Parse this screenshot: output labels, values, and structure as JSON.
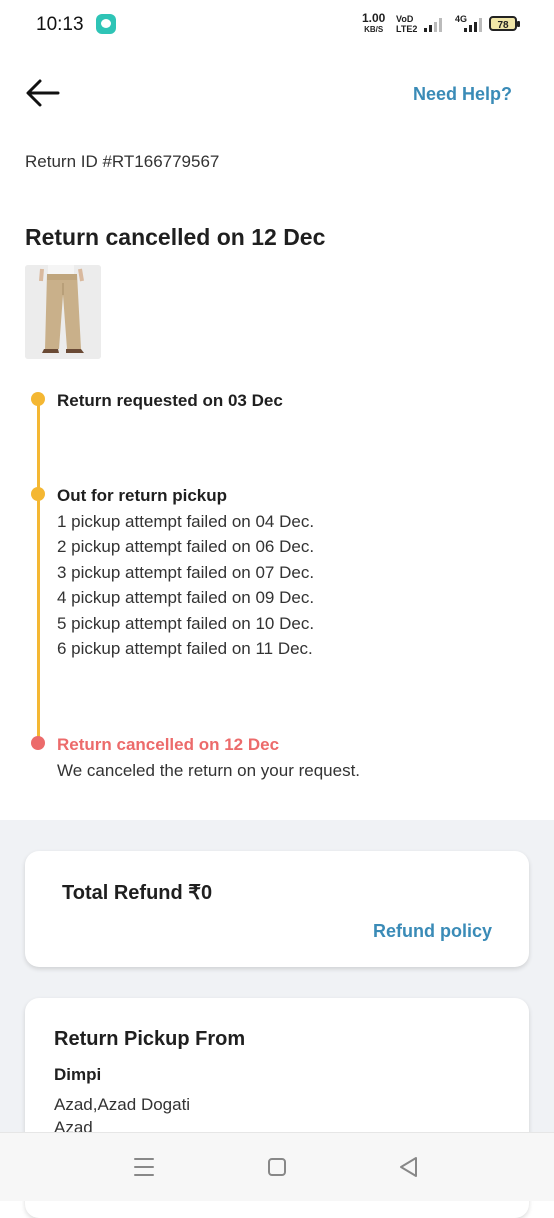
{
  "status_bar": {
    "time": "10:13",
    "network_speed_value": "1.00",
    "network_speed_unit": "KB/S",
    "volte_top": "VoD",
    "volte_bottom": "LTE2",
    "network_type": "4G",
    "battery": "78"
  },
  "header": {
    "help_label": "Need Help?"
  },
  "return_id": "Return ID #RT166779567",
  "status_title": "Return cancelled on 12 Dec",
  "timeline": [
    {
      "title": "Return requested on 03 Dec",
      "lines": []
    },
    {
      "title": "Out for return pickup",
      "lines": [
        "1 pickup attempt failed on 04 Dec.",
        "2 pickup attempt failed on 06 Dec.",
        "3 pickup attempt failed on 07 Dec.",
        "4 pickup attempt failed on 09 Dec.",
        "5 pickup attempt failed on 10 Dec.",
        "6 pickup attempt failed on 11 Dec."
      ]
    },
    {
      "title": "Return cancelled on 12 Dec",
      "lines": [
        "We canceled the return on your request."
      ]
    }
  ],
  "colors": {
    "timeline_active": "#f4b733",
    "timeline_cancelled": "#ec6b6b",
    "link": "#3a8bb7"
  },
  "refund": {
    "total_label": "Total Refund ₹0",
    "policy_label": "Refund policy"
  },
  "pickup": {
    "title": "Return Pickup From",
    "name": "Dimpi",
    "address_lines": [
      "Azad,Azad Dogati",
      "Azad"
    ]
  },
  "nav": {
    "icons": [
      "menu-icon",
      "home-square-icon",
      "back-triangle-icon"
    ]
  }
}
